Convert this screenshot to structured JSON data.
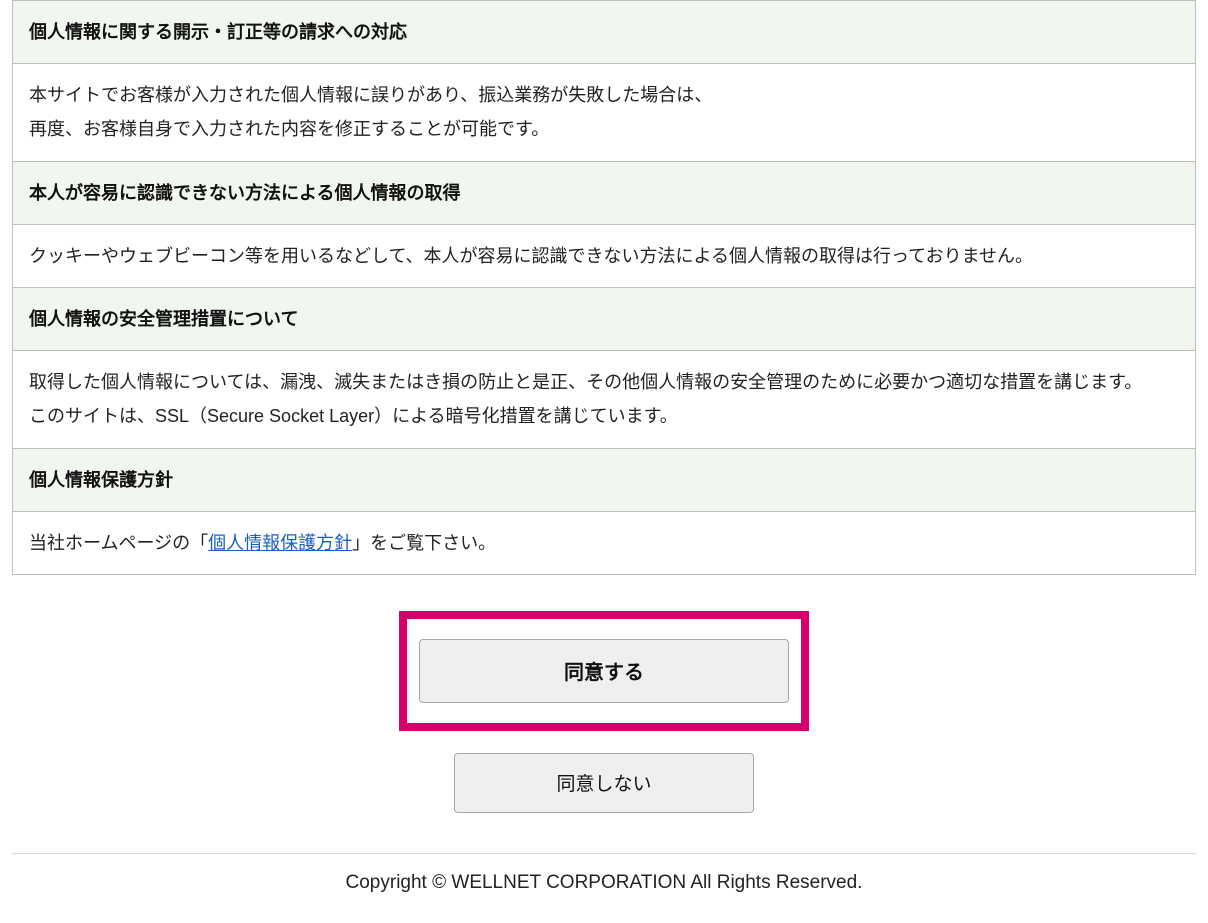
{
  "sections": [
    {
      "heading": "個人情報に関する開示・訂正等の請求への対応",
      "body": "本サイトでお客様が入力された個人情報に誤りがあり、振込業務が失敗した場合は、\n再度、お客様自身で入力された内容を修正することが可能です。"
    },
    {
      "heading": "本人が容易に認識できない方法による個人情報の取得",
      "body": "クッキーやウェブビーコン等を用いるなどして、本人が容易に認識できない方法による個人情報の取得は行っておりません。"
    },
    {
      "heading": "個人情報の安全管理措置について",
      "body": "取得した個人情報については、漏洩、滅失またはき損の防止と是正、その他個人情報の安全管理のために必要かつ適切な措置を講じます。\nこのサイトは、SSL（Secure Socket Layer）による暗号化措置を講じています。"
    },
    {
      "heading": "個人情報保護方針",
      "body_prefix": "当社ホームページの「",
      "body_link": "個人情報保護方針",
      "body_suffix": "」をご覧下さい。"
    }
  ],
  "buttons": {
    "agree": "同意する",
    "disagree": "同意しない"
  },
  "footer": "Copyright © WELLNET CORPORATION All Rights Reserved."
}
